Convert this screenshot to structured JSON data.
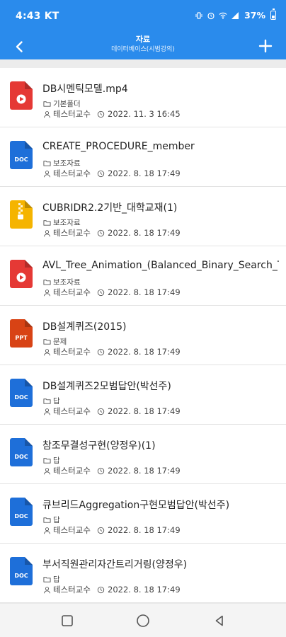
{
  "status_bar": {
    "time": "4:43",
    "carrier": "KT",
    "battery": "37%"
  },
  "app_bar": {
    "title": "자료",
    "subtitle": "데이터베이스(시범강의)"
  },
  "files": [
    {
      "name": "DB시멘틱모델.mp4",
      "folder": "기본폴더",
      "author": "테스터교수",
      "date": "2022. 11. 3 16:45",
      "type": "video",
      "icon": "video-file-icon",
      "color": "#e53935"
    },
    {
      "name": "CREATE_PROCEDURE_member",
      "folder": "보조자료",
      "author": "테스터교수",
      "date": "2022. 8. 18 17:49",
      "type": "doc",
      "icon": "doc-file-icon",
      "color": "#1e6fd9"
    },
    {
      "name": "CUBRIDR2.2기반_대학교재(1)",
      "folder": "보조자료",
      "author": "테스터교수",
      "date": "2022. 8. 18 17:49",
      "type": "zip",
      "icon": "zip-file-icon",
      "color": "#f5b400"
    },
    {
      "name": "AVL_Tree_Animation_(Balanced_Binary_Search_Tr...",
      "folder": "보조자료",
      "author": "테스터교수",
      "date": "2022. 8. 18 17:49",
      "type": "video",
      "icon": "video-file-icon",
      "color": "#e53935"
    },
    {
      "name": "DB설계퀴즈(2015)",
      "folder": "문제",
      "author": "테스터교수",
      "date": "2022. 8. 18 17:49",
      "type": "ppt",
      "icon": "ppt-file-icon",
      "color": "#d84315"
    },
    {
      "name": "DB설계퀴즈2모범답안(박선주)",
      "folder": "답",
      "author": "테스터교수",
      "date": "2022. 8. 18 17:49",
      "type": "doc",
      "icon": "doc-file-icon",
      "color": "#1e6fd9"
    },
    {
      "name": "참조무결성구현(양정우)(1)",
      "folder": "답",
      "author": "테스터교수",
      "date": "2022. 8. 18 17:49",
      "type": "doc",
      "icon": "doc-file-icon",
      "color": "#1e6fd9"
    },
    {
      "name": "큐브리드Aggregation구현모범답안(박선주)",
      "folder": "답",
      "author": "테스터교수",
      "date": "2022. 8. 18 17:49",
      "type": "doc",
      "icon": "doc-file-icon",
      "color": "#1e6fd9"
    },
    {
      "name": "부서직원관리자간트리거링(양정우)",
      "folder": "답",
      "author": "테스터교수",
      "date": "2022. 8. 18 17:49",
      "type": "doc",
      "icon": "doc-file-icon",
      "color": "#1e6fd9"
    }
  ],
  "colors": {
    "accent": "#2a8bec",
    "divider": "#e3e3e3"
  },
  "icon_labels": {
    "doc": "DOC",
    "ppt": "PPT"
  }
}
